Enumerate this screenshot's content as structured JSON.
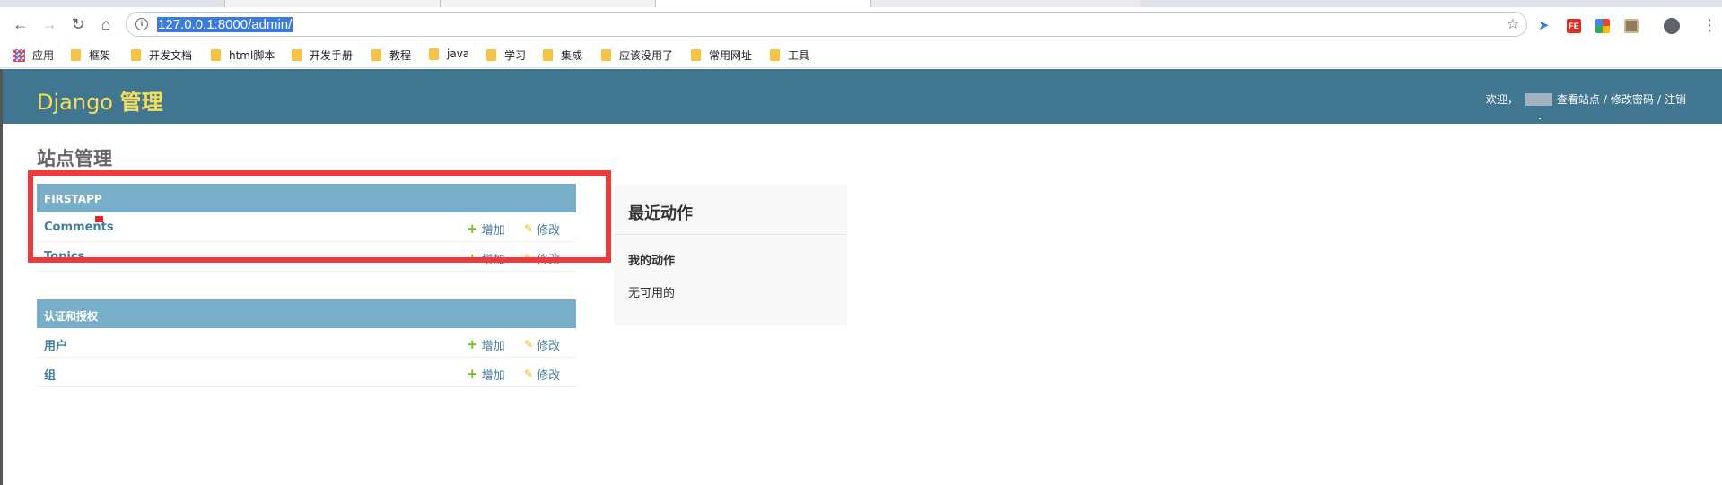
{
  "browser": {
    "url": "127.0.0.1:8000/admin/",
    "bookmarks": [
      "应用",
      "框架",
      "开发文档",
      "html脚本",
      "开发手册",
      "教程",
      "java",
      "学习",
      "集成",
      "应该没用了",
      "常用网址",
      "工具"
    ],
    "extension_label": "FE"
  },
  "header": {
    "brand_prefix": "Django",
    "brand_suffix": "管理",
    "welcome": "欢迎，",
    "view_site": "查看站点",
    "change_password": "修改密码",
    "logout": "注销",
    "separator": "/"
  },
  "content": {
    "title": "站点管理"
  },
  "modules": [
    {
      "caption": "FIRSTAPP",
      "rows": [
        {
          "name": "Comments",
          "add": "增加",
          "change": "修改"
        },
        {
          "name": "Topics",
          "add": "增加",
          "change": "修改"
        }
      ]
    },
    {
      "caption": "认证和授权",
      "rows": [
        {
          "name": "用户",
          "add": "增加",
          "change": "修改"
        },
        {
          "name": "组",
          "add": "增加",
          "change": "修改"
        }
      ]
    }
  ],
  "recent_actions": {
    "title": "最近动作",
    "subtitle": "我的动作",
    "empty": "无可用的"
  },
  "icons": {
    "add": "plus-icon",
    "change": "pencil-icon"
  },
  "colors": {
    "header_bg": "#417690",
    "brand": "#f5dd5d",
    "caption_bg": "#79aec8",
    "link": "#447e9b",
    "add_icon": "#70bf2b",
    "change_icon": "#efb80b",
    "annotation": "#f03a3a"
  }
}
